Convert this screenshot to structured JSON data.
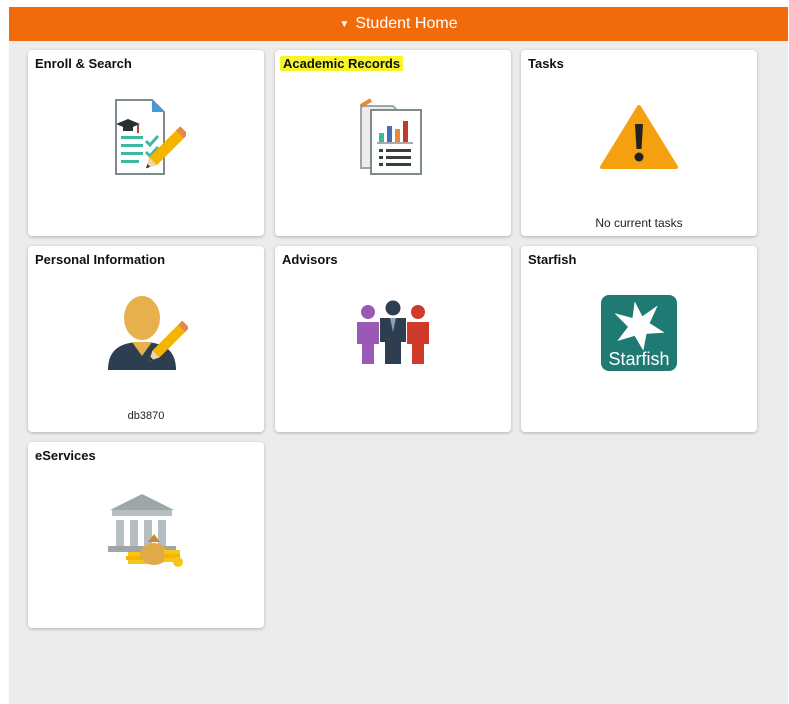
{
  "header": {
    "title": "Student Home"
  },
  "tiles": [
    {
      "title": "Enroll & Search",
      "icon": "enrollment-document-icon"
    },
    {
      "title": "Academic Records",
      "icon": "academic-records-chart-icon"
    },
    {
      "title": "Tasks",
      "icon": "warning-icon",
      "subtext": "No current tasks"
    },
    {
      "title": "Personal Information",
      "icon": "user-edit-icon",
      "subtext": "db3870"
    },
    {
      "title": "Advisors",
      "icon": "people-group-icon"
    },
    {
      "title": "Starfish",
      "icon": "starfish-logo-icon",
      "logo_text": "Starfish"
    },
    {
      "title": "eServices",
      "icon": "bank-payment-icon"
    }
  ],
  "colors": {
    "banner": "#f26b0b",
    "background": "#ececec",
    "highlight": "#f7f52a",
    "warning": "#f5a00f",
    "starfish": "#1f7a73"
  }
}
